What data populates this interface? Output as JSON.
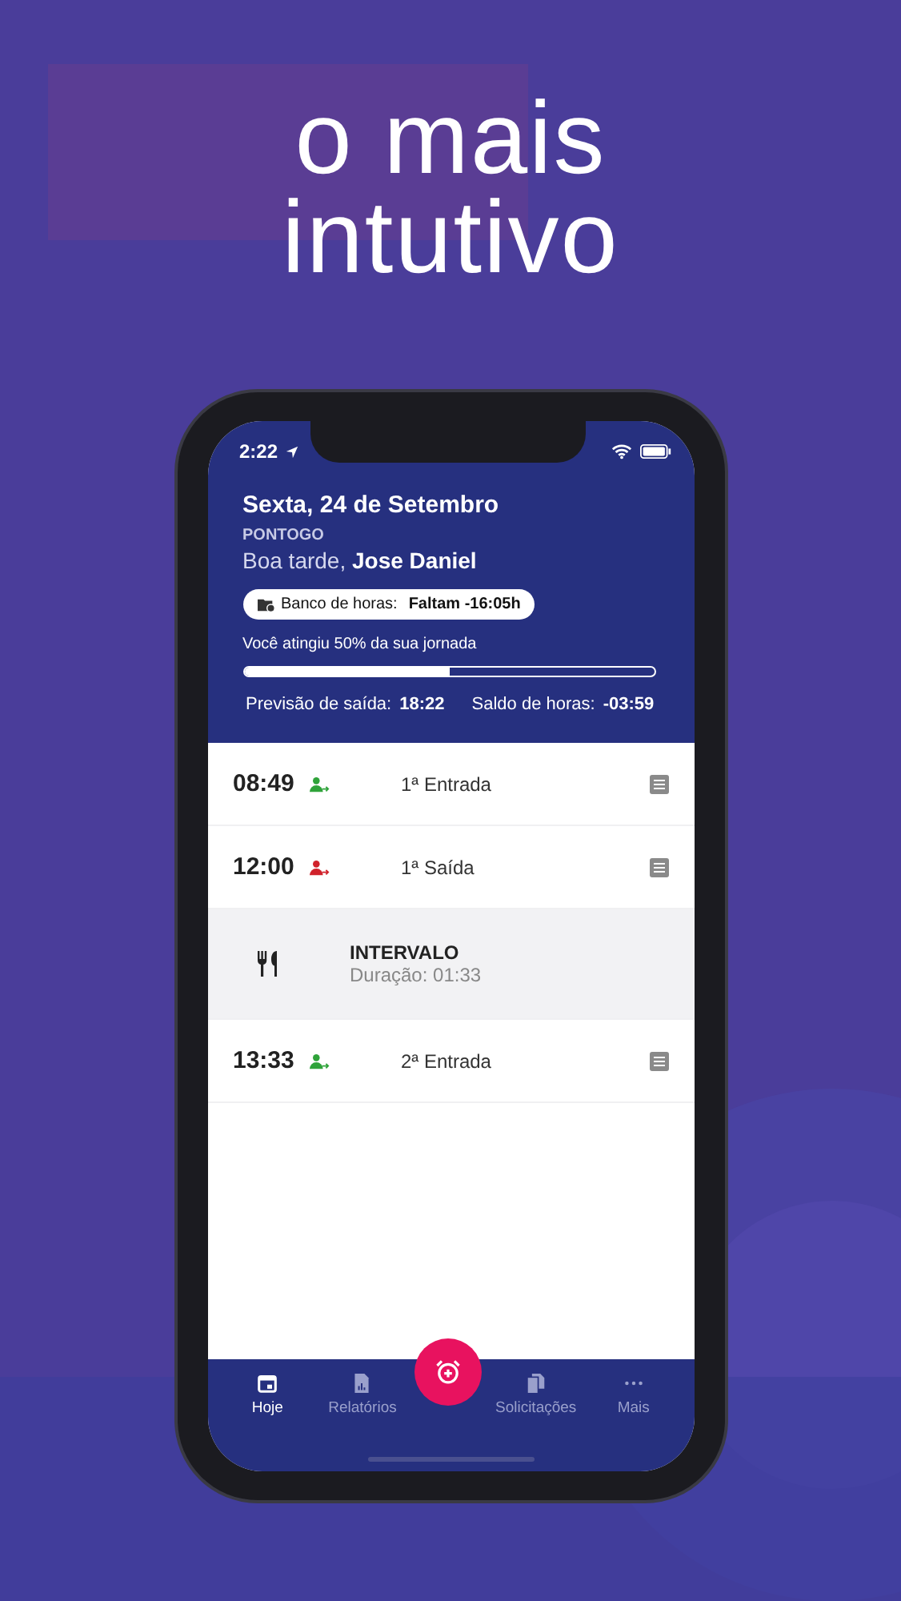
{
  "headline": "o mais intutivo",
  "status_bar": {
    "time": "2:22"
  },
  "header": {
    "date": "Sexta, 24 de Setembro",
    "brand": "PONTOGO",
    "greeting": "Boa tarde, **Jose Daniel**",
    "bank_label": "Banco de horas:",
    "bank_value": "Faltam -16:05h",
    "progress_text": "Você atingiu 50% da sua jornada",
    "progress": {
      "level": 0.5
    },
    "exit_label": "Previsão de saída:",
    "exit_value": "18:22",
    "balance_label": "Saldo de horas:",
    "balance_value": "-03:59"
  },
  "entries": [
    {
      "kind": "in",
      "time": "08:49",
      "label": "1ª Entrada"
    },
    {
      "kind": "out",
      "time": "12:00",
      "label": "1ª Saída"
    },
    {
      "kind": "break",
      "title": "INTERVALO",
      "subtitle": "Duração: 01:33"
    },
    {
      "kind": "in",
      "time": "13:33",
      "label": "2ª Entrada"
    }
  ],
  "nav": [
    {
      "kind": "calendar",
      "label": "Hoje",
      "selected": true
    },
    {
      "kind": "report",
      "label": "Relatórios",
      "selected": false
    },
    {
      "kind": "fab"
    },
    {
      "kind": "documents",
      "label": "Solicitações",
      "selected": false
    },
    {
      "kind": "more",
      "label": "Mais",
      "selected": false
    }
  ]
}
